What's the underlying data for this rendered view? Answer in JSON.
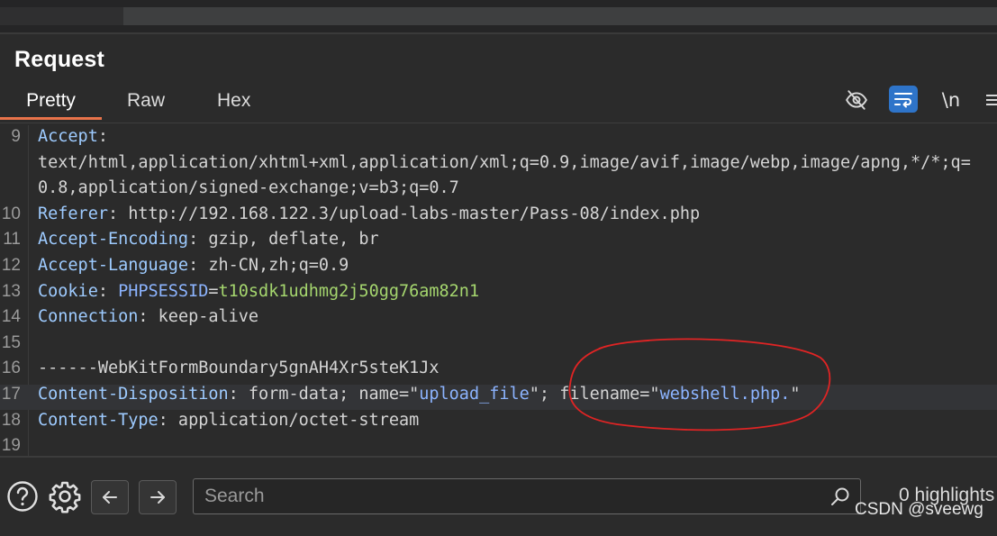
{
  "header": {
    "title": "Request"
  },
  "tabs": [
    {
      "label": "Pretty",
      "active": true
    },
    {
      "label": "Raw",
      "active": false
    },
    {
      "label": "Hex",
      "active": false
    }
  ],
  "toolbar": {
    "icons": [
      "eye-off-icon",
      "wrap-lines-icon",
      "newline-icon",
      "menu-icon"
    ],
    "newline_label": "\\n",
    "active_icon_color": "#2e74c9"
  },
  "editor": {
    "lines": [
      {
        "num": "9",
        "segments": [
          [
            "key",
            "Accept"
          ],
          [
            "val",
            ":"
          ]
        ]
      },
      {
        "num": "",
        "segments": [
          [
            "val",
            "text/html,application/xhtml+xml,application/xml;q=0.9,image/avif,image/webp,image/apng,*/*;q="
          ]
        ]
      },
      {
        "num": "",
        "segments": [
          [
            "val",
            "0.8,application/signed-exchange;v=b3;q=0.7"
          ]
        ]
      },
      {
        "num": "10",
        "segments": [
          [
            "key",
            "Referer"
          ],
          [
            "val",
            ": http://192.168.122.3/upload-labs-master/Pass-08/index.php"
          ]
        ]
      },
      {
        "num": "11",
        "segments": [
          [
            "key",
            "Accept-Encoding"
          ],
          [
            "val",
            ": gzip, deflate, br"
          ]
        ]
      },
      {
        "num": "12",
        "segments": [
          [
            "key",
            "Accept-Language"
          ],
          [
            "val",
            ": zh-CN,zh;q=0.9"
          ]
        ]
      },
      {
        "num": "13",
        "segments": [
          [
            "key",
            "Cookie"
          ],
          [
            "val",
            ": "
          ],
          [
            "str",
            "PHPSESSID"
          ],
          [
            "val",
            "="
          ],
          [
            "green",
            "t10sdk1udhmg2j50gg76am82n1"
          ]
        ]
      },
      {
        "num": "14",
        "segments": [
          [
            "key",
            "Connection"
          ],
          [
            "val",
            ": keep-alive"
          ]
        ]
      },
      {
        "num": "15",
        "segments": []
      },
      {
        "num": "16",
        "segments": [
          [
            "val",
            "------WebKitFormBoundary5gnAH4Xr5steK1Jx"
          ]
        ]
      },
      {
        "num": "17",
        "highlight": true,
        "segments": [
          [
            "key",
            "Content-Disposition"
          ],
          [
            "val",
            ": form-data; name=\""
          ],
          [
            "str",
            "upload_file"
          ],
          [
            "val",
            "\"; filename=\""
          ],
          [
            "str",
            "webshell.php."
          ],
          [
            "val",
            "\""
          ]
        ]
      },
      {
        "num": "18",
        "segments": [
          [
            "key",
            "Content-Type"
          ],
          [
            "val",
            ": application/octet-stream"
          ]
        ]
      },
      {
        "num": "19",
        "segments": []
      }
    ]
  },
  "footer": {
    "search_placeholder": "Search",
    "highlights": "0 highlights",
    "watermark": "CSDN @sveewg"
  }
}
